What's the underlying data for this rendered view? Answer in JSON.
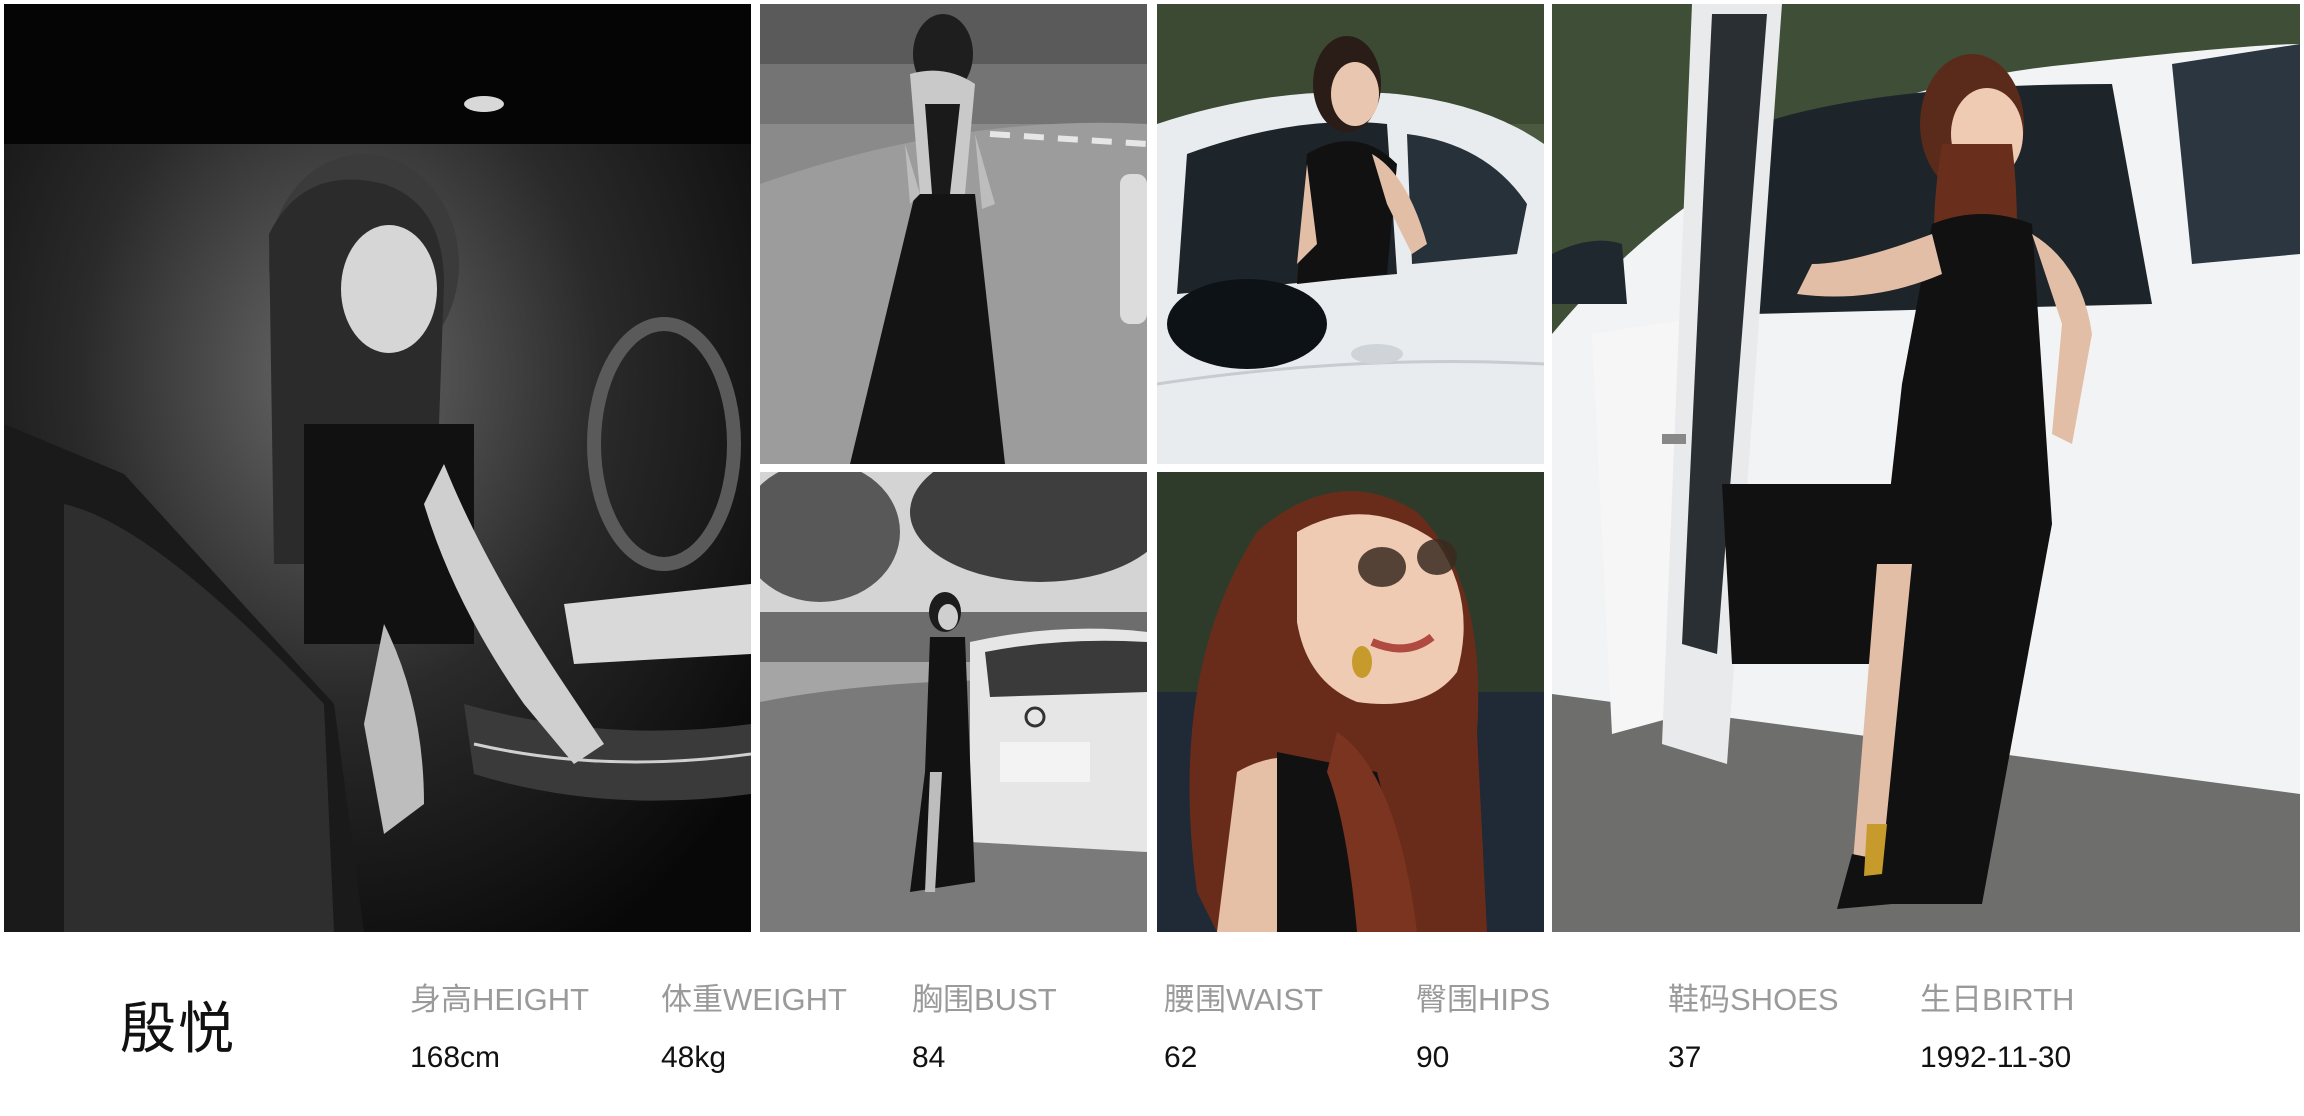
{
  "model": {
    "name": "殷悦"
  },
  "stats": [
    {
      "label": "身高HEIGHT",
      "value": "168cm"
    },
    {
      "label": "体重WEIGHT",
      "value": "48kg"
    },
    {
      "label": "胸围BUST",
      "value": "84"
    },
    {
      "label": "腰围WAIST",
      "value": "62"
    },
    {
      "label": "臀围HIPS",
      "value": "90"
    },
    {
      "label": "鞋码SHOES",
      "value": "37"
    },
    {
      "label": "生日BIRTH",
      "value": "1992-11-30"
    }
  ],
  "colors": {
    "background": "#ffffff",
    "label": "#9a9a9a",
    "value": "#111111"
  }
}
